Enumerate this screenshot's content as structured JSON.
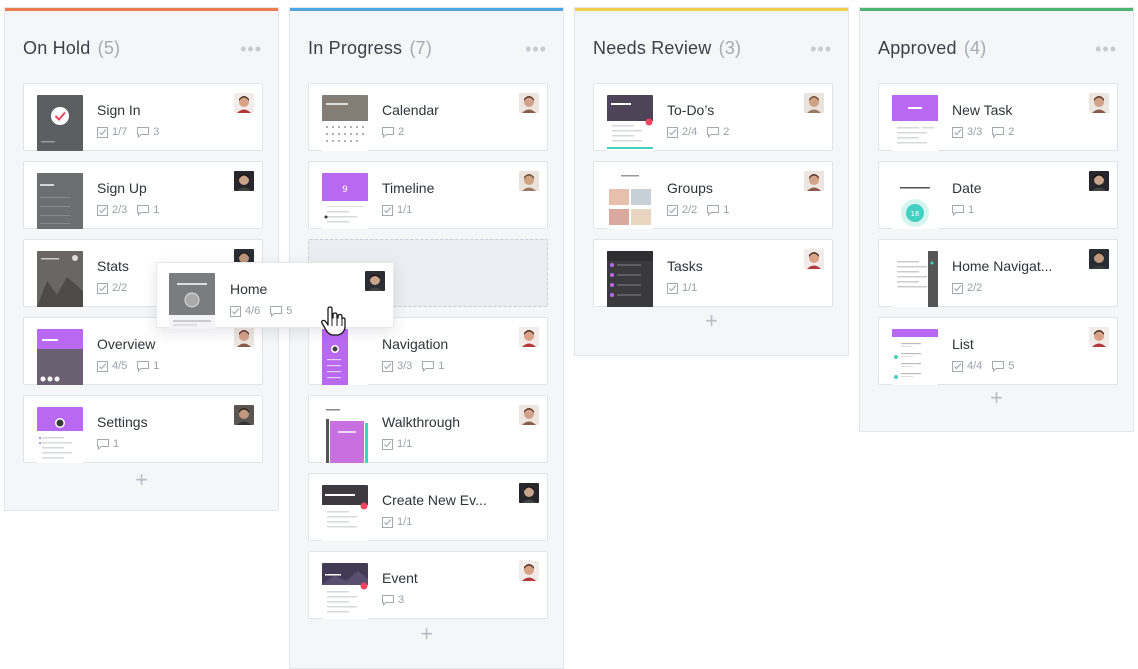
{
  "columns": [
    {
      "title": "On Hold",
      "count": "(5)",
      "accent": "#ef7d50",
      "cards": [
        {
          "title": "Sign In",
          "tasks": "1/7",
          "comments": "3",
          "thumb": "signin",
          "avatar": "a1"
        },
        {
          "title": "Sign Up",
          "tasks": "2/3",
          "comments": "1",
          "thumb": "signup",
          "avatar": "a2"
        },
        {
          "title": "Stats",
          "tasks": "2/2",
          "comments": "",
          "thumb": "stats",
          "avatar": "a3"
        },
        {
          "title": "Overview",
          "tasks": "4/5",
          "comments": "1",
          "thumb": "overview",
          "avatar": "a4"
        },
        {
          "title": "Settings",
          "tasks": "",
          "comments": "1",
          "thumb": "settings",
          "avatar": "a5"
        }
      ]
    },
    {
      "title": "In Progress",
      "count": "(7)",
      "accent": "#4fa5e0",
      "cards": [
        {
          "title": "Calendar",
          "tasks": "",
          "comments": "2",
          "thumb": "calendar",
          "avatar": "a4"
        },
        {
          "title": "Timeline",
          "tasks": "1/1",
          "comments": "",
          "thumb": "timeline",
          "avatar": "a6"
        },
        {
          "title": "Navigation",
          "tasks": "3/3",
          "comments": "1",
          "thumb": "navigation",
          "avatar": "a1"
        },
        {
          "title": "Walkthrough",
          "tasks": "1/1",
          "comments": "",
          "thumb": "walkthrough",
          "avatar": "a4"
        },
        {
          "title": "Create New Ev...",
          "tasks": "1/1",
          "comments": "",
          "thumb": "createevent",
          "avatar": "a2"
        },
        {
          "title": "Event",
          "tasks": "",
          "comments": "3",
          "thumb": "event",
          "avatar": "a1"
        }
      ]
    },
    {
      "title": "Needs Review",
      "count": "(3)",
      "accent": "#f2cf4a",
      "cards": [
        {
          "title": "To-Do’s",
          "tasks": "2/4",
          "comments": "2",
          "thumb": "todos",
          "avatar": "a6"
        },
        {
          "title": "Groups",
          "tasks": "2/2",
          "comments": "1",
          "thumb": "groups",
          "avatar": "a4"
        },
        {
          "title": "Tasks",
          "tasks": "1/1",
          "comments": "",
          "thumb": "tasks",
          "avatar": "a1"
        }
      ]
    },
    {
      "title": "Approved",
      "count": "(4)",
      "accent": "#4cb572",
      "cards": [
        {
          "title": "New Task",
          "tasks": "3/3",
          "comments": "2",
          "thumb": "newtask",
          "avatar": "a4"
        },
        {
          "title": "Date",
          "tasks": "",
          "comments": "1",
          "thumb": "date",
          "avatar": "a2"
        },
        {
          "title": "Home Navigat...",
          "tasks": "2/2",
          "comments": "",
          "thumb": "homenav",
          "avatar": "a3"
        },
        {
          "title": "List",
          "tasks": "4/4",
          "comments": "5",
          "thumb": "list",
          "avatar": "a1"
        }
      ]
    }
  ],
  "dragging_card": {
    "title": "Home",
    "tasks": "4/6",
    "comments": "5",
    "thumb": "home",
    "avatar": "a2"
  },
  "add_label": "+",
  "menu_label": "•••",
  "icons": {
    "tasks": "checkbox-icon",
    "comments": "comment-icon",
    "cursor": "hand-cursor-icon"
  },
  "colors": {
    "purple": "#b968f2",
    "pink_dot": "#f4435f",
    "teal": "#45d1c2"
  }
}
